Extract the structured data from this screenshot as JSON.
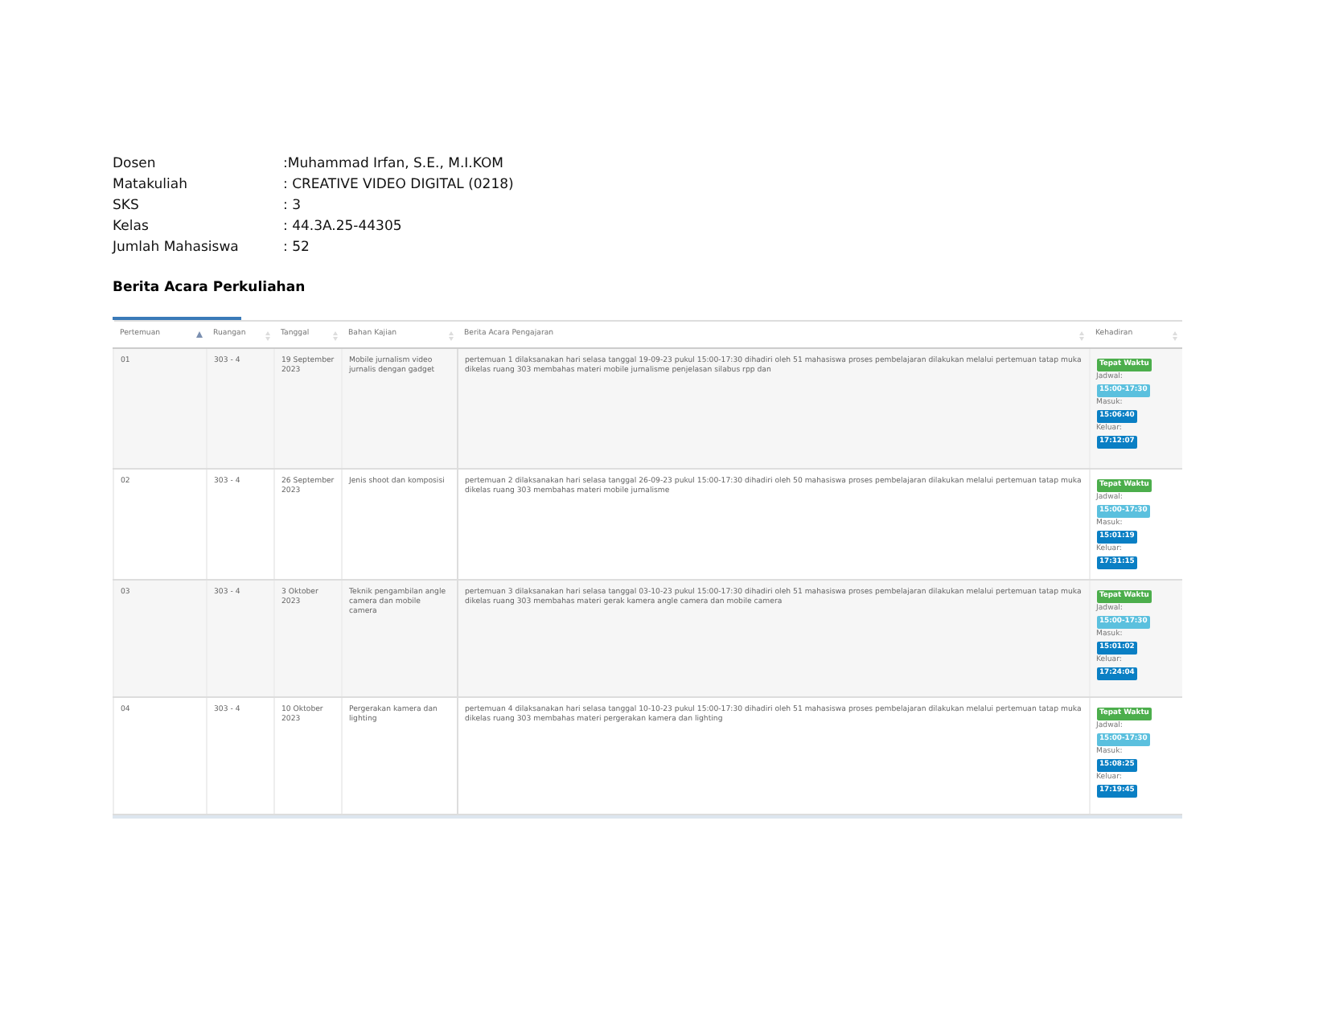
{
  "info": [
    {
      "label": "Dosen",
      "value": ":Muhammad Irfan, S.E., M.I.KOM"
    },
    {
      "label": "Matakuliah",
      "value": ": CREATIVE VIDEO DIGITAL (0218)"
    },
    {
      "label": "SKS",
      "value": ": 3"
    },
    {
      "label": "Kelas",
      "value": ": 44.3A.25-44305"
    },
    {
      "label": "Jumlah Mahasiswa",
      "value": ": 52"
    }
  ],
  "section_title": "Berita Acara Perkuliahan",
  "table": {
    "columns": [
      {
        "label": "Pertemuan",
        "sorted": true
      },
      {
        "label": "Ruangan",
        "sorted": false
      },
      {
        "label": "Tanggal",
        "sorted": false
      },
      {
        "label": "Bahan Kajian",
        "sorted": false
      },
      {
        "label": "Berita Acara Pengajaran",
        "sorted": false
      },
      {
        "label": "Kehadiran",
        "sorted": false
      }
    ],
    "rows": [
      {
        "pertemuan": "01",
        "ruangan": "303 - 4",
        "tanggal": "19 September 2023",
        "bahan": "Mobile jurnalism video jurnalis dengan gadget",
        "berita": "pertemuan 1 dilaksanakan hari selasa tanggal 19-09-23 pukul 15:00-17:30 dihadiri oleh 51 mahasiswa proses pembelajaran dilakukan melalui pertemuan tatap muka dikelas ruang 303 membahas materi mobile jurnalisme penjelasan silabus rpp dan",
        "status": "Tepat Waktu",
        "jadwal_label": "Jadwal:",
        "jadwal": "15:00-17:30",
        "masuk_label": "Masuk:",
        "masuk": "15:06:40",
        "keluar_label": "Keluar:",
        "keluar": "17:12:07"
      },
      {
        "pertemuan": "02",
        "ruangan": "303 - 4",
        "tanggal": "26 September 2023",
        "bahan": "Jenis shoot dan komposisi",
        "berita": "pertemuan 2 dilaksanakan hari selasa tanggal 26-09-23 pukul 15:00-17:30 dihadiri oleh 50 mahasiswa proses pembelajaran dilakukan melalui pertemuan tatap muka dikelas ruang 303 membahas materi mobile jurnalisme",
        "status": "Tepat Waktu",
        "jadwal_label": "Jadwal:",
        "jadwal": "15:00-17:30",
        "masuk_label": "Masuk:",
        "masuk": "15:01:19",
        "keluar_label": "Keluar:",
        "keluar": "17:31:15"
      },
      {
        "pertemuan": "03",
        "ruangan": "303 - 4",
        "tanggal": "3 Oktober 2023",
        "bahan": "Teknik pengambilan angle camera dan mobile camera",
        "berita": "pertemuan 3 dilaksanakan hari selasa tanggal 03-10-23 pukul 15:00-17:30 dihadiri oleh 51 mahasiswa proses pembelajaran dilakukan melalui pertemuan tatap muka dikelas ruang 303 membahas materi gerak kamera angle camera dan mobile camera",
        "status": "Tepat Waktu",
        "jadwal_label": "Jadwal:",
        "jadwal": "15:00-17:30",
        "masuk_label": "Masuk:",
        "masuk": "15:01:02",
        "keluar_label": "Keluar:",
        "keluar": "17:24:04"
      },
      {
        "pertemuan": "04",
        "ruangan": "303 - 4",
        "tanggal": "10 Oktober 2023",
        "bahan": "Pergerakan kamera dan lighting",
        "berita": "pertemuan 4 dilaksanakan hari selasa tanggal 10-10-23 pukul 15:00-17:30 dihadiri oleh 51 mahasiswa proses pembelajaran dilakukan melalui pertemuan tatap muka dikelas ruang 303 membahas materi pergerakan kamera dan lighting",
        "status": "Tepat Waktu",
        "jadwal_label": "Jadwal:",
        "jadwal": "15:00-17:30",
        "masuk_label": "Masuk:",
        "masuk": "15:08:25",
        "keluar_label": "Keluar:",
        "keluar": "17:19:45"
      }
    ]
  }
}
